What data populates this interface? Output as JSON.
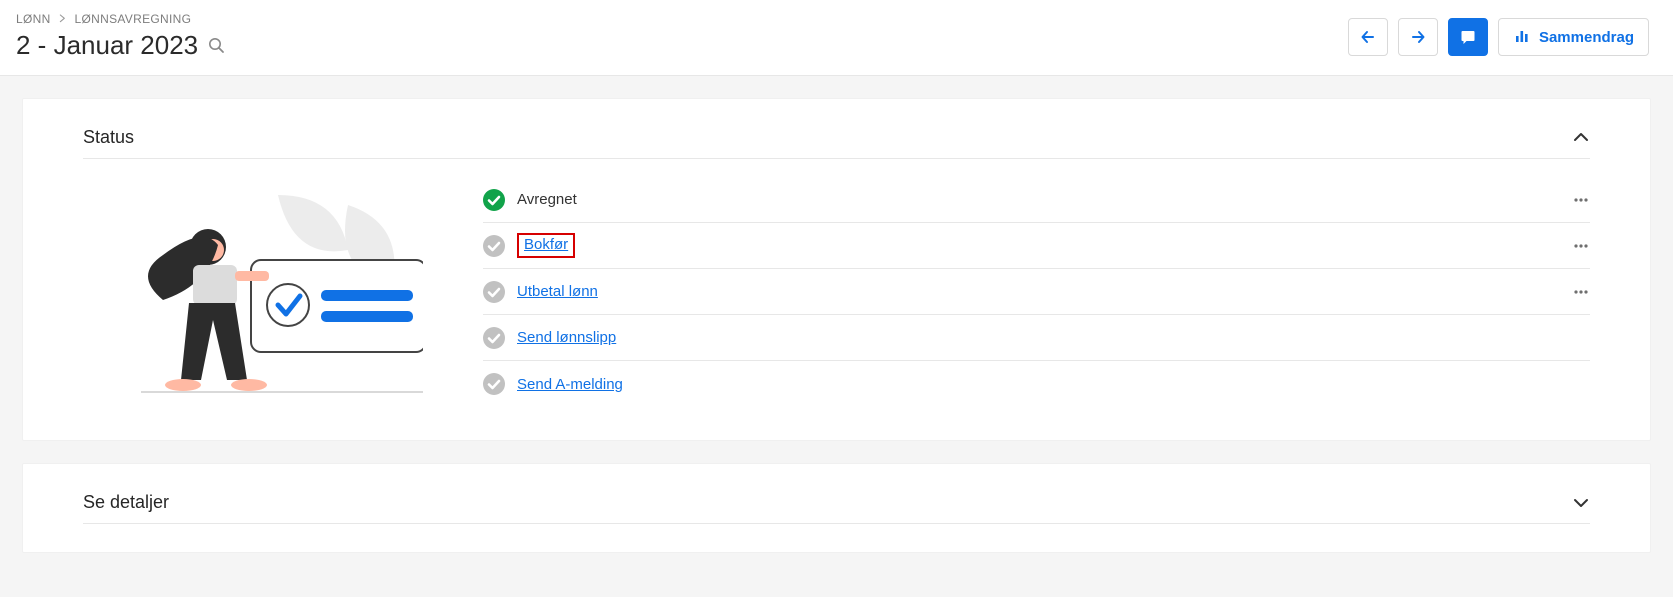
{
  "breadcrumb": {
    "items": [
      "LØNN",
      "LØNNSAVREGNING"
    ]
  },
  "page_title": "2 - Januar 2023",
  "header_buttons": {
    "summary_label": "Sammendrag"
  },
  "status_card": {
    "title": "Status",
    "steps": [
      {
        "label": "Avregnet",
        "state": "done",
        "is_link": false,
        "has_menu": true,
        "highlighted": false
      },
      {
        "label": "Bokfør",
        "state": "pending",
        "is_link": true,
        "has_menu": true,
        "highlighted": true
      },
      {
        "label": "Utbetal lønn",
        "state": "pending",
        "is_link": true,
        "has_menu": true,
        "highlighted": false
      },
      {
        "label": "Send lønnslipp",
        "state": "pending",
        "is_link": true,
        "has_menu": false,
        "highlighted": false
      },
      {
        "label": "Send A-melding",
        "state": "pending",
        "is_link": true,
        "has_menu": false,
        "highlighted": false
      }
    ]
  },
  "details_card": {
    "title": "Se detaljer"
  },
  "colors": {
    "blue": "#1071e5",
    "green": "#11a34a",
    "gray_circle": "#c1c1c1",
    "highlight_border": "#d60000"
  }
}
